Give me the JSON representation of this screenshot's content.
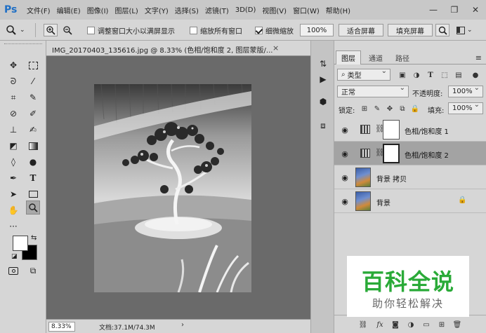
{
  "menubar": {
    "logo": "Ps",
    "items": [
      "文件(F)",
      "编辑(E)",
      "图像(I)",
      "图层(L)",
      "文字(Y)",
      "选择(S)",
      "滤镜(T)",
      "3D(D)",
      "视图(V)",
      "窗口(W)",
      "帮助(H)"
    ],
    "minimize": "—",
    "restore": "❐",
    "close": "✕"
  },
  "options": {
    "zoom_icon": "🔍",
    "resize_windows": "调整窗口大小以满屏显示",
    "zoom_all": "缩放所有窗口",
    "scrubby_zoom": "细微缩放",
    "zoom_value": "100%",
    "fit_screen": "适合屏幕",
    "fill_screen": "填充屏幕"
  },
  "document": {
    "tab_title": "IMG_20170403_135616.jpg @ 8.33% (色相/饱和度 2, 图层蒙版/...",
    "tab_close": "×",
    "zoom": "8.33%",
    "doc_info": "文档:37.1M/74.3M",
    "info_arrow": "›"
  },
  "layers_panel": {
    "tabs": [
      "图层",
      "通道",
      "路径"
    ],
    "menu": "≡",
    "filter_kind": "类型",
    "blend_mode": "正常",
    "opacity_label": "不透明度:",
    "opacity_value": "100%",
    "lock_label": "锁定:",
    "fill_label": "填充:",
    "fill_value": "100%",
    "layers": [
      {
        "name": "色相/饱和度 1",
        "type": "adjustment",
        "selected": false
      },
      {
        "name": "色相/饱和度 2",
        "type": "adjustment",
        "selected": true
      },
      {
        "name": "背景 拷贝",
        "type": "image",
        "selected": false
      },
      {
        "name": "背景",
        "type": "image",
        "selected": false,
        "locked": true
      }
    ]
  },
  "watermark": {
    "title": "百科全说",
    "subtitle": "助你轻松解决"
  }
}
